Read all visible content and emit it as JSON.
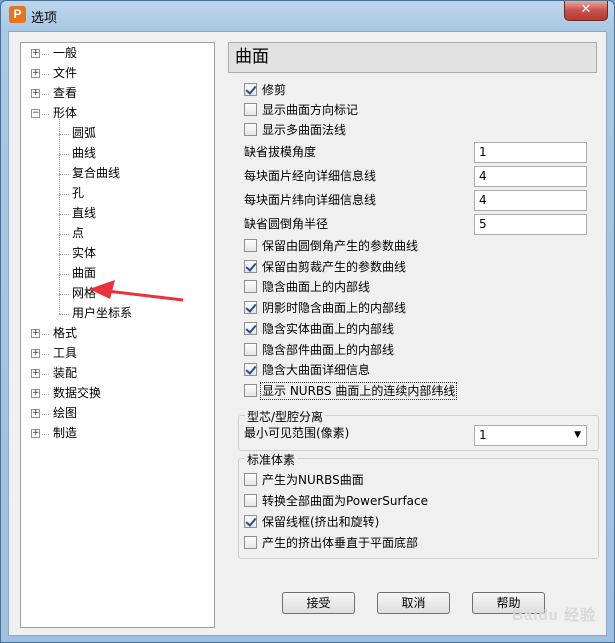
{
  "window": {
    "title": "选项",
    "app_icon_letter": "P",
    "close_glyph": "✕"
  },
  "tree": {
    "items": [
      {
        "label": "一般",
        "level": 0,
        "expander": "+"
      },
      {
        "label": "文件",
        "level": 0,
        "expander": "+"
      },
      {
        "label": "查看",
        "level": 0,
        "expander": "+"
      },
      {
        "label": "形体",
        "level": 0,
        "expander": "−"
      },
      {
        "label": "圆弧",
        "level": 1
      },
      {
        "label": "曲线",
        "level": 1
      },
      {
        "label": "复合曲线",
        "level": 1
      },
      {
        "label": "孔",
        "level": 1
      },
      {
        "label": "直线",
        "level": 1
      },
      {
        "label": "点",
        "level": 1
      },
      {
        "label": "实体",
        "level": 1
      },
      {
        "label": "曲面",
        "level": 1,
        "selected": true
      },
      {
        "label": "网格",
        "level": 1
      },
      {
        "label": "用户坐标系",
        "level": 1
      },
      {
        "label": "格式",
        "level": 0,
        "expander": "+"
      },
      {
        "label": "工具",
        "level": 0,
        "expander": "+"
      },
      {
        "label": "装配",
        "level": 0,
        "expander": "+"
      },
      {
        "label": "数据交换",
        "level": 0,
        "expander": "+"
      },
      {
        "label": "绘图",
        "level": 0,
        "expander": "+"
      },
      {
        "label": "制造",
        "level": 0,
        "expander": "+"
      }
    ]
  },
  "panel": {
    "title": "曲面",
    "top_checks": [
      {
        "label": "修剪",
        "checked": true
      },
      {
        "label": "显示曲面方向标记",
        "checked": false
      },
      {
        "label": "显示多曲面法线",
        "checked": false
      }
    ],
    "fields": [
      {
        "label": "缺省拔模角度",
        "value": "1"
      },
      {
        "label": "每块面片经向详细信息线",
        "value": "4"
      },
      {
        "label": "每块面片纬向详细信息线",
        "value": "4"
      },
      {
        "label": "缺省圆倒角半径",
        "value": "5"
      }
    ],
    "bottom_checks": [
      {
        "label": "保留由圆倒角产生的参数曲线",
        "checked": false
      },
      {
        "label": "保留由剪裁产生的参数曲线",
        "checked": true
      },
      {
        "label": "隐含曲面上的内部线",
        "checked": false
      },
      {
        "label": "阴影时隐含曲面上的内部线",
        "checked": true
      },
      {
        "label": "隐含实体曲面上的内部线",
        "checked": true
      },
      {
        "label": "隐含部件曲面上的内部线",
        "checked": false
      },
      {
        "label": "隐含大曲面详细信息",
        "checked": true
      },
      {
        "label": "显示 NURBS 曲面上的连续内部纬线",
        "checked": false,
        "focused": true
      }
    ],
    "core_cavity": {
      "title": "型芯/型腔分离",
      "label": "最小可见范围(像素)",
      "value": "1",
      "caret": "▼"
    },
    "std_body": {
      "title": "标准体素",
      "checks": [
        {
          "label": "产生为NURBS曲面",
          "checked": false
        },
        {
          "label": "转换全部曲面为PowerSurface",
          "checked": false
        },
        {
          "label": "保留线框(挤出和旋转)",
          "checked": true
        },
        {
          "label": "产生的挤出体垂直于平面底部",
          "checked": false
        }
      ]
    }
  },
  "buttons": {
    "ok": "接受",
    "cancel": "取消",
    "help": "帮助"
  },
  "watermark": "Baidu 经验",
  "colors": {
    "annotation_arrow": "#e8333a",
    "checkmark": "#1e4f96"
  }
}
